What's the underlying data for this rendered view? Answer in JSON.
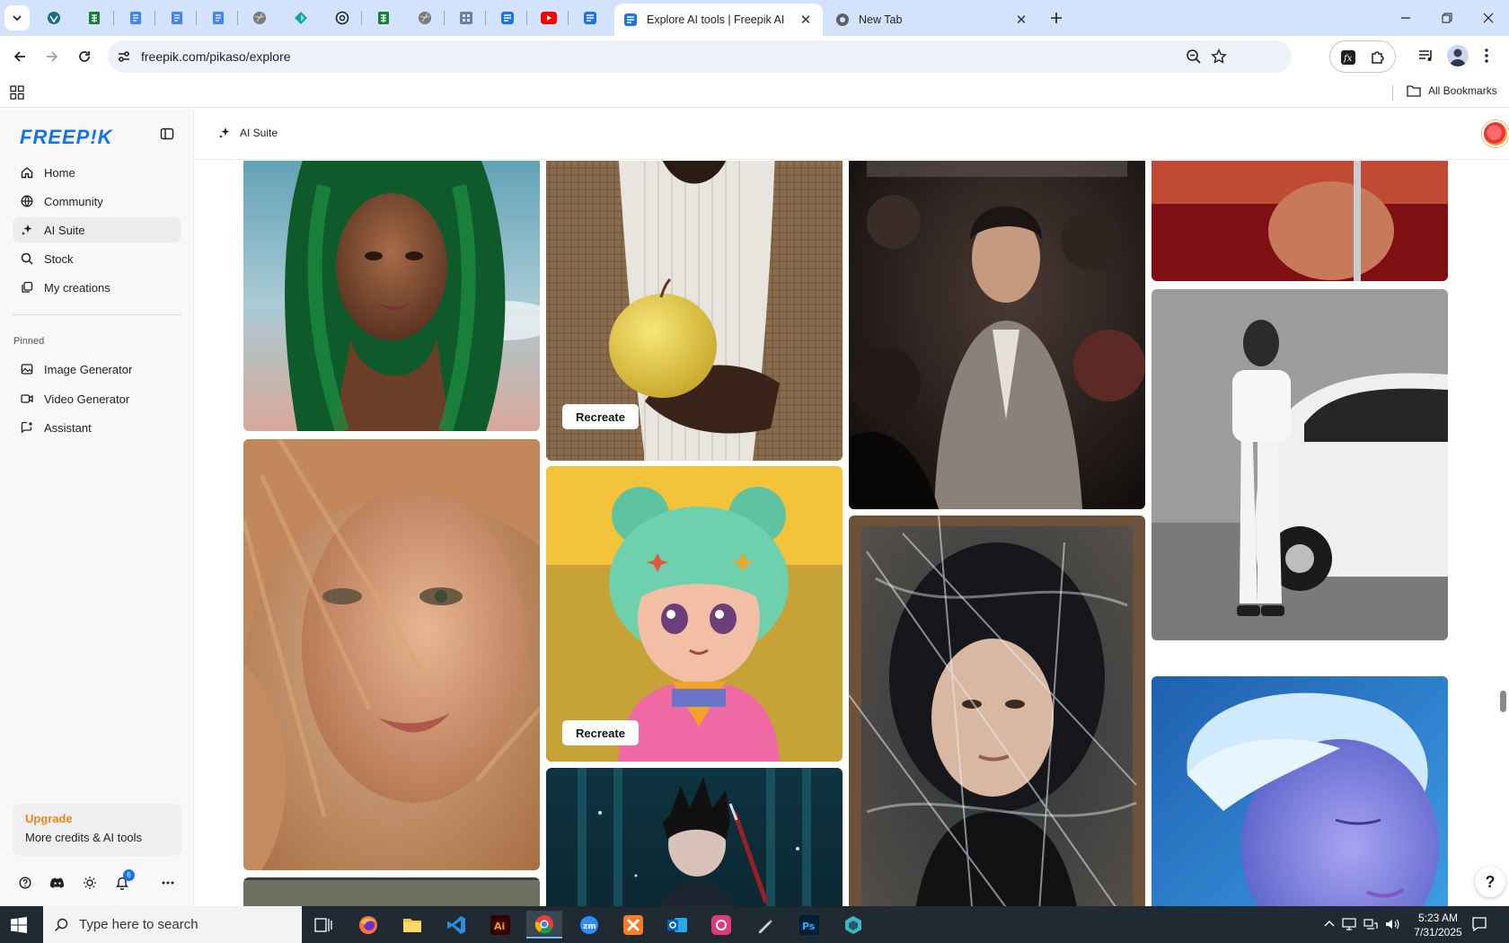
{
  "browser": {
    "tabs": [
      {
        "title": "Explore AI tools | Freepik AI",
        "active": true
      },
      {
        "title": "New Tab",
        "active": false
      }
    ],
    "address": "freepik.com/pikaso/explore",
    "bookmarks": {
      "all_label": "All Bookmarks"
    }
  },
  "sidebar": {
    "logo": "FREEP!K",
    "nav": [
      {
        "label": "Home",
        "icon": "home-icon"
      },
      {
        "label": "Community",
        "icon": "globe-icon"
      },
      {
        "label": "AI Suite",
        "icon": "sparkle-icon",
        "active": true
      },
      {
        "label": "Stock",
        "icon": "search-icon"
      },
      {
        "label": "My creations",
        "icon": "stack-icon"
      }
    ],
    "pinned_label": "Pinned",
    "pinned": [
      {
        "label": "Image Generator",
        "icon": "image-icon"
      },
      {
        "label": "Video Generator",
        "icon": "video-icon"
      },
      {
        "label": "Assistant",
        "icon": "assistant-icon"
      }
    ],
    "upgrade": {
      "title": "Upgrade",
      "subtitle": "More credits & AI tools"
    },
    "notification_count": "6"
  },
  "header": {
    "crumb": "AI Suite"
  },
  "gallery": {
    "recreate_label": "Recreate",
    "help_label": "?"
  },
  "taskbar": {
    "search_placeholder": "Type here to search",
    "time": "5:23 AM",
    "date": "7/31/2025"
  },
  "colors": {
    "brand": "#1273eb",
    "upgrade": "#ea8620",
    "tabstrip": "#d3e3fd",
    "taskbar": "#1f2a33"
  }
}
